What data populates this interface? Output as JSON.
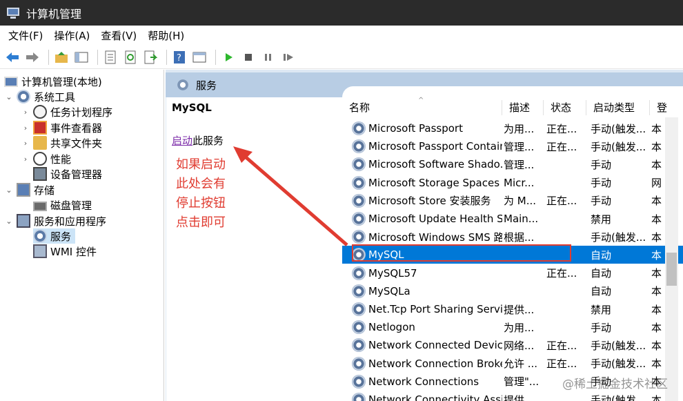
{
  "window": {
    "title": "计算机管理"
  },
  "menu": [
    "文件(F)",
    "操作(A)",
    "查看(V)",
    "帮助(H)"
  ],
  "tree": {
    "root": "计算机管理(本地)",
    "system_tools": "系统工具",
    "task_scheduler": "任务计划程序",
    "event_viewer": "事件查看器",
    "shared_folders": "共享文件夹",
    "performance": "性能",
    "device_manager": "设备管理器",
    "storage": "存储",
    "disk_management": "磁盘管理",
    "services_apps": "服务和应用程序",
    "services": "服务",
    "wmi": "WMI 控件"
  },
  "pane": {
    "header": "服务",
    "service_name": "MySQL",
    "start_link": "启动",
    "start_suffix": "此服务",
    "annotation": [
      "如果启动",
      "此处会有",
      "停止按钮",
      "点击即可"
    ]
  },
  "columns": [
    "名称",
    "描述",
    "状态",
    "启动类型",
    "登"
  ],
  "services": [
    {
      "name": "Microsoft Passport",
      "desc": "为用...",
      "status": "正在...",
      "startup": "手动(触发...",
      "logon": "本"
    },
    {
      "name": "Microsoft Passport Container",
      "desc": "管理...",
      "status": "正在...",
      "startup": "手动(触发...",
      "logon": "本"
    },
    {
      "name": "Microsoft Software Shado...",
      "desc": "管理...",
      "status": "",
      "startup": "手动",
      "logon": "本"
    },
    {
      "name": "Microsoft Storage Spaces S...",
      "desc": "Micr...",
      "status": "",
      "startup": "手动",
      "logon": "网"
    },
    {
      "name": "Microsoft Store 安装服务",
      "desc": "为 M...",
      "status": "正在...",
      "startup": "手动",
      "logon": "本"
    },
    {
      "name": "Microsoft Update Health S...",
      "desc": "Main...",
      "status": "",
      "startup": "禁用",
      "logon": "本"
    },
    {
      "name": "Microsoft Windows SMS 路...",
      "desc": "根据...",
      "status": "",
      "startup": "手动(触发...",
      "logon": "本"
    },
    {
      "name": "MySQL",
      "desc": "",
      "status": "",
      "startup": "自动",
      "logon": "本",
      "selected": true
    },
    {
      "name": "MySQL57",
      "desc": "",
      "status": "正在...",
      "startup": "自动",
      "logon": "本"
    },
    {
      "name": "MySQLa",
      "desc": "",
      "status": "",
      "startup": "自动",
      "logon": "本"
    },
    {
      "name": "Net.Tcp Port Sharing Service",
      "desc": "提供...",
      "status": "",
      "startup": "禁用",
      "logon": "本"
    },
    {
      "name": "Netlogon",
      "desc": "为用...",
      "status": "",
      "startup": "手动",
      "logon": "本"
    },
    {
      "name": "Network Connected Devic...",
      "desc": "网络...",
      "status": "正在...",
      "startup": "手动(触发...",
      "logon": "本"
    },
    {
      "name": "Network Connection Broker",
      "desc": "允许 ...",
      "status": "正在...",
      "startup": "手动(触发...",
      "logon": "本"
    },
    {
      "name": "Network Connections",
      "desc": "管理\"...",
      "status": "",
      "startup": "手动",
      "logon": "本"
    },
    {
      "name": "Network Connectivity Assis...",
      "desc": "提供...",
      "status": "",
      "startup": "手动(触发...",
      "logon": "本"
    }
  ],
  "watermark": "@稀土掘金技术社区",
  "colors": {
    "selected": "#0078d7",
    "annotation": "#e03c31",
    "link": "#7b2aa8"
  }
}
